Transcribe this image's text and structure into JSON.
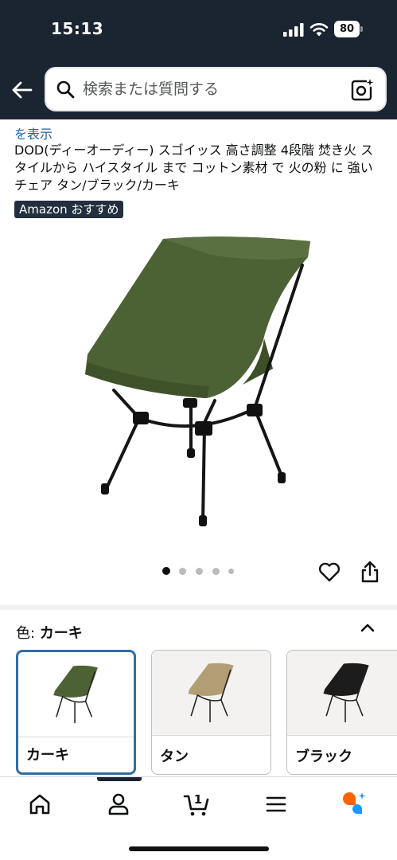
{
  "status_bar": {
    "time": "15:13",
    "battery": "80"
  },
  "search": {
    "placeholder": "検索または質問する"
  },
  "product": {
    "partial_link": "を表示",
    "title": "DOD(ディーオーディー) スゴイッス 高さ調整 4段階 焚き火 スタイルから ハイスタイル まで コットン素材 で 火の粉 に 強い チェア タン/ブラック/カーキ",
    "badge": "Amazon おすすめ",
    "image_count": 5,
    "current_image_index": 0
  },
  "variation": {
    "label": "色:",
    "selected": "カーキ",
    "options": [
      {
        "label": "カーキ",
        "color": "#4d6234",
        "selected": true
      },
      {
        "label": "タン",
        "color": "#b29e74",
        "selected": false
      },
      {
        "label": "ブラック",
        "color": "#1c1c1c",
        "selected": false
      }
    ]
  },
  "nav": {
    "items": [
      "home-icon",
      "account-icon",
      "cart-icon",
      "menu-icon",
      "rufus-icon"
    ],
    "cart_count": "1"
  }
}
